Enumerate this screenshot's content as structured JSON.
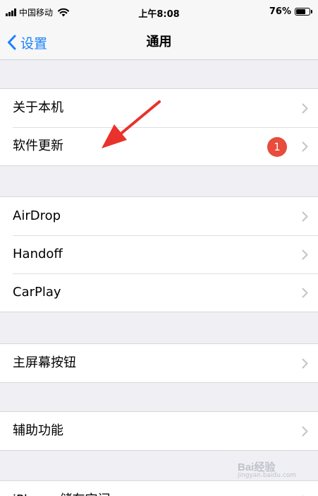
{
  "status_bar": {
    "carrier": "中国移动",
    "time": "上午8:08",
    "battery_percent": "76%",
    "battery_level": 0.76,
    "signal_icon": "signal-icon",
    "wifi_icon": "wifi-icon"
  },
  "nav": {
    "back_label": "设置",
    "title": "通用",
    "accent_color": "#1a82fb"
  },
  "groups": [
    {
      "rows": [
        {
          "label": "关于本机"
        },
        {
          "label": "软件更新",
          "badge": "1"
        }
      ]
    },
    {
      "rows": [
        {
          "label": "AirDrop"
        },
        {
          "label": "Handoff"
        },
        {
          "label": "CarPlay"
        }
      ]
    },
    {
      "rows": [
        {
          "label": "主屏幕按钮"
        }
      ]
    },
    {
      "rows": [
        {
          "label": "辅助功能"
        }
      ]
    },
    {
      "rows": [
        {
          "label": "iPhone 储存空间"
        }
      ]
    }
  ],
  "annotation": {
    "icon": "red-arrow-icon",
    "color": "#e8322b"
  },
  "watermark": {
    "text": "Bai经验",
    "subtext": "jingyan.baidu.com"
  }
}
